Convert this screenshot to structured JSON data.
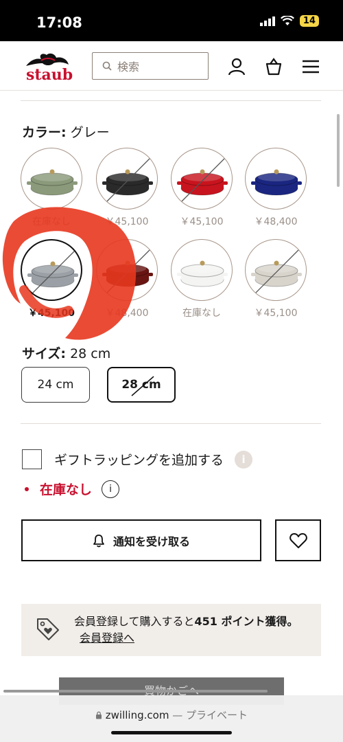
{
  "status_bar": {
    "time": "17:08",
    "battery": "14"
  },
  "header": {
    "logo_text": "staub",
    "search_placeholder": "検索"
  },
  "color_selector": {
    "label_prefix": "カラー:",
    "label_value": "グレー",
    "swatches": [
      {
        "name": "sage",
        "price": "在庫なし",
        "selected": false,
        "crossed": false,
        "color": "#8b9a7a"
      },
      {
        "name": "black",
        "price": "￥45,100",
        "selected": false,
        "crossed": true,
        "color": "#2a2a2a"
      },
      {
        "name": "cherry",
        "price": "￥45,100",
        "selected": false,
        "crossed": true,
        "color": "#c8141e"
      },
      {
        "name": "blue",
        "price": "￥48,400",
        "selected": false,
        "crossed": false,
        "color": "#1a2680"
      },
      {
        "name": "grey",
        "price": "￥45,100",
        "selected": true,
        "crossed": true,
        "color": "#9aa0a6"
      },
      {
        "name": "bordeaux",
        "price": "￥48,400",
        "selected": false,
        "crossed": true,
        "color": "#6a1512"
      },
      {
        "name": "white",
        "price": "在庫なし",
        "selected": false,
        "crossed": false,
        "color": "#f4f4f2"
      },
      {
        "name": "linen",
        "price": "￥45,100",
        "selected": false,
        "crossed": true,
        "color": "#d8d4cc"
      }
    ]
  },
  "size_selector": {
    "label_prefix": "サイズ:",
    "label_value": "28 cm",
    "options": [
      {
        "label": "24 cm",
        "selected": false
      },
      {
        "label": "28 cm",
        "selected": true
      }
    ]
  },
  "gift": {
    "label": "ギフトラッピングを追加する",
    "info": "i"
  },
  "stock": {
    "status": "在庫なし",
    "info": "i"
  },
  "actions": {
    "notify_label": "通知を受け取る"
  },
  "points": {
    "text_before": "会員登録して購入すると",
    "points_value": "451 ポイント獲得。",
    "link_label": "会員登録へ"
  },
  "cart_button_peek": "買物かごへ",
  "browser": {
    "domain": "zwilling.com",
    "mode": "— プライベート"
  },
  "colors": {
    "brand_red": "#c8102e",
    "scribble_red": "#e8371f"
  }
}
